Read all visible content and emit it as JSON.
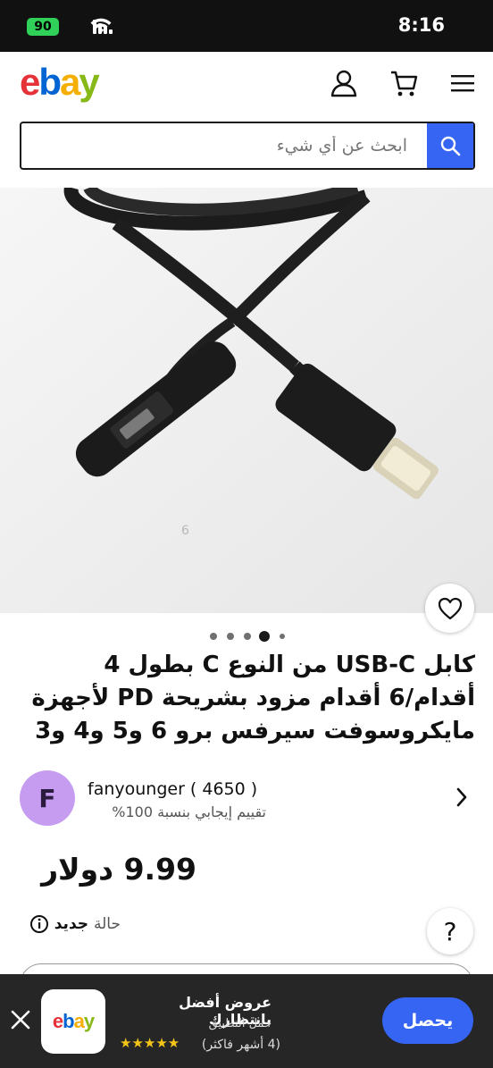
{
  "status_bar": {
    "battery": "90",
    "time": "8:16"
  },
  "header": {
    "logo": {
      "e": "e",
      "b": "b",
      "a": "a",
      "y": "y"
    },
    "icons": [
      "account-icon",
      "cart-icon",
      "menu-icon"
    ],
    "search": {
      "placeholder": "ابحث عن أي شيء"
    }
  },
  "gallery": {
    "image_count": 5,
    "active_index": 3,
    "watermark": "6"
  },
  "product": {
    "title": "كابل USB-C من النوع C بطول 4 أقدام/6 أقدام مزود بشريحة PD لأجهزة مايكروسوفت سيرفس برو 6 و5 و4 و3",
    "price": "9.99 دولار",
    "condition_value": "جديد",
    "condition_label": "حالة"
  },
  "seller": {
    "initial": "F",
    "name": "fanyounger ( 4650 )",
    "feedback": "تقييم إيجابي بنسبة 100%"
  },
  "help": {
    "label": "?"
  },
  "app_banner": {
    "title": "عروض أفضل بانتظارك",
    "subtitle": "حمل التطبيق",
    "stars": "★★★★★",
    "rating_text": "(4 أشهر فاكثر)",
    "get_label": "يحصل"
  },
  "colors": {
    "accent": "#3665f3",
    "avatar": "#c59cf0",
    "star": "#f5c518"
  }
}
